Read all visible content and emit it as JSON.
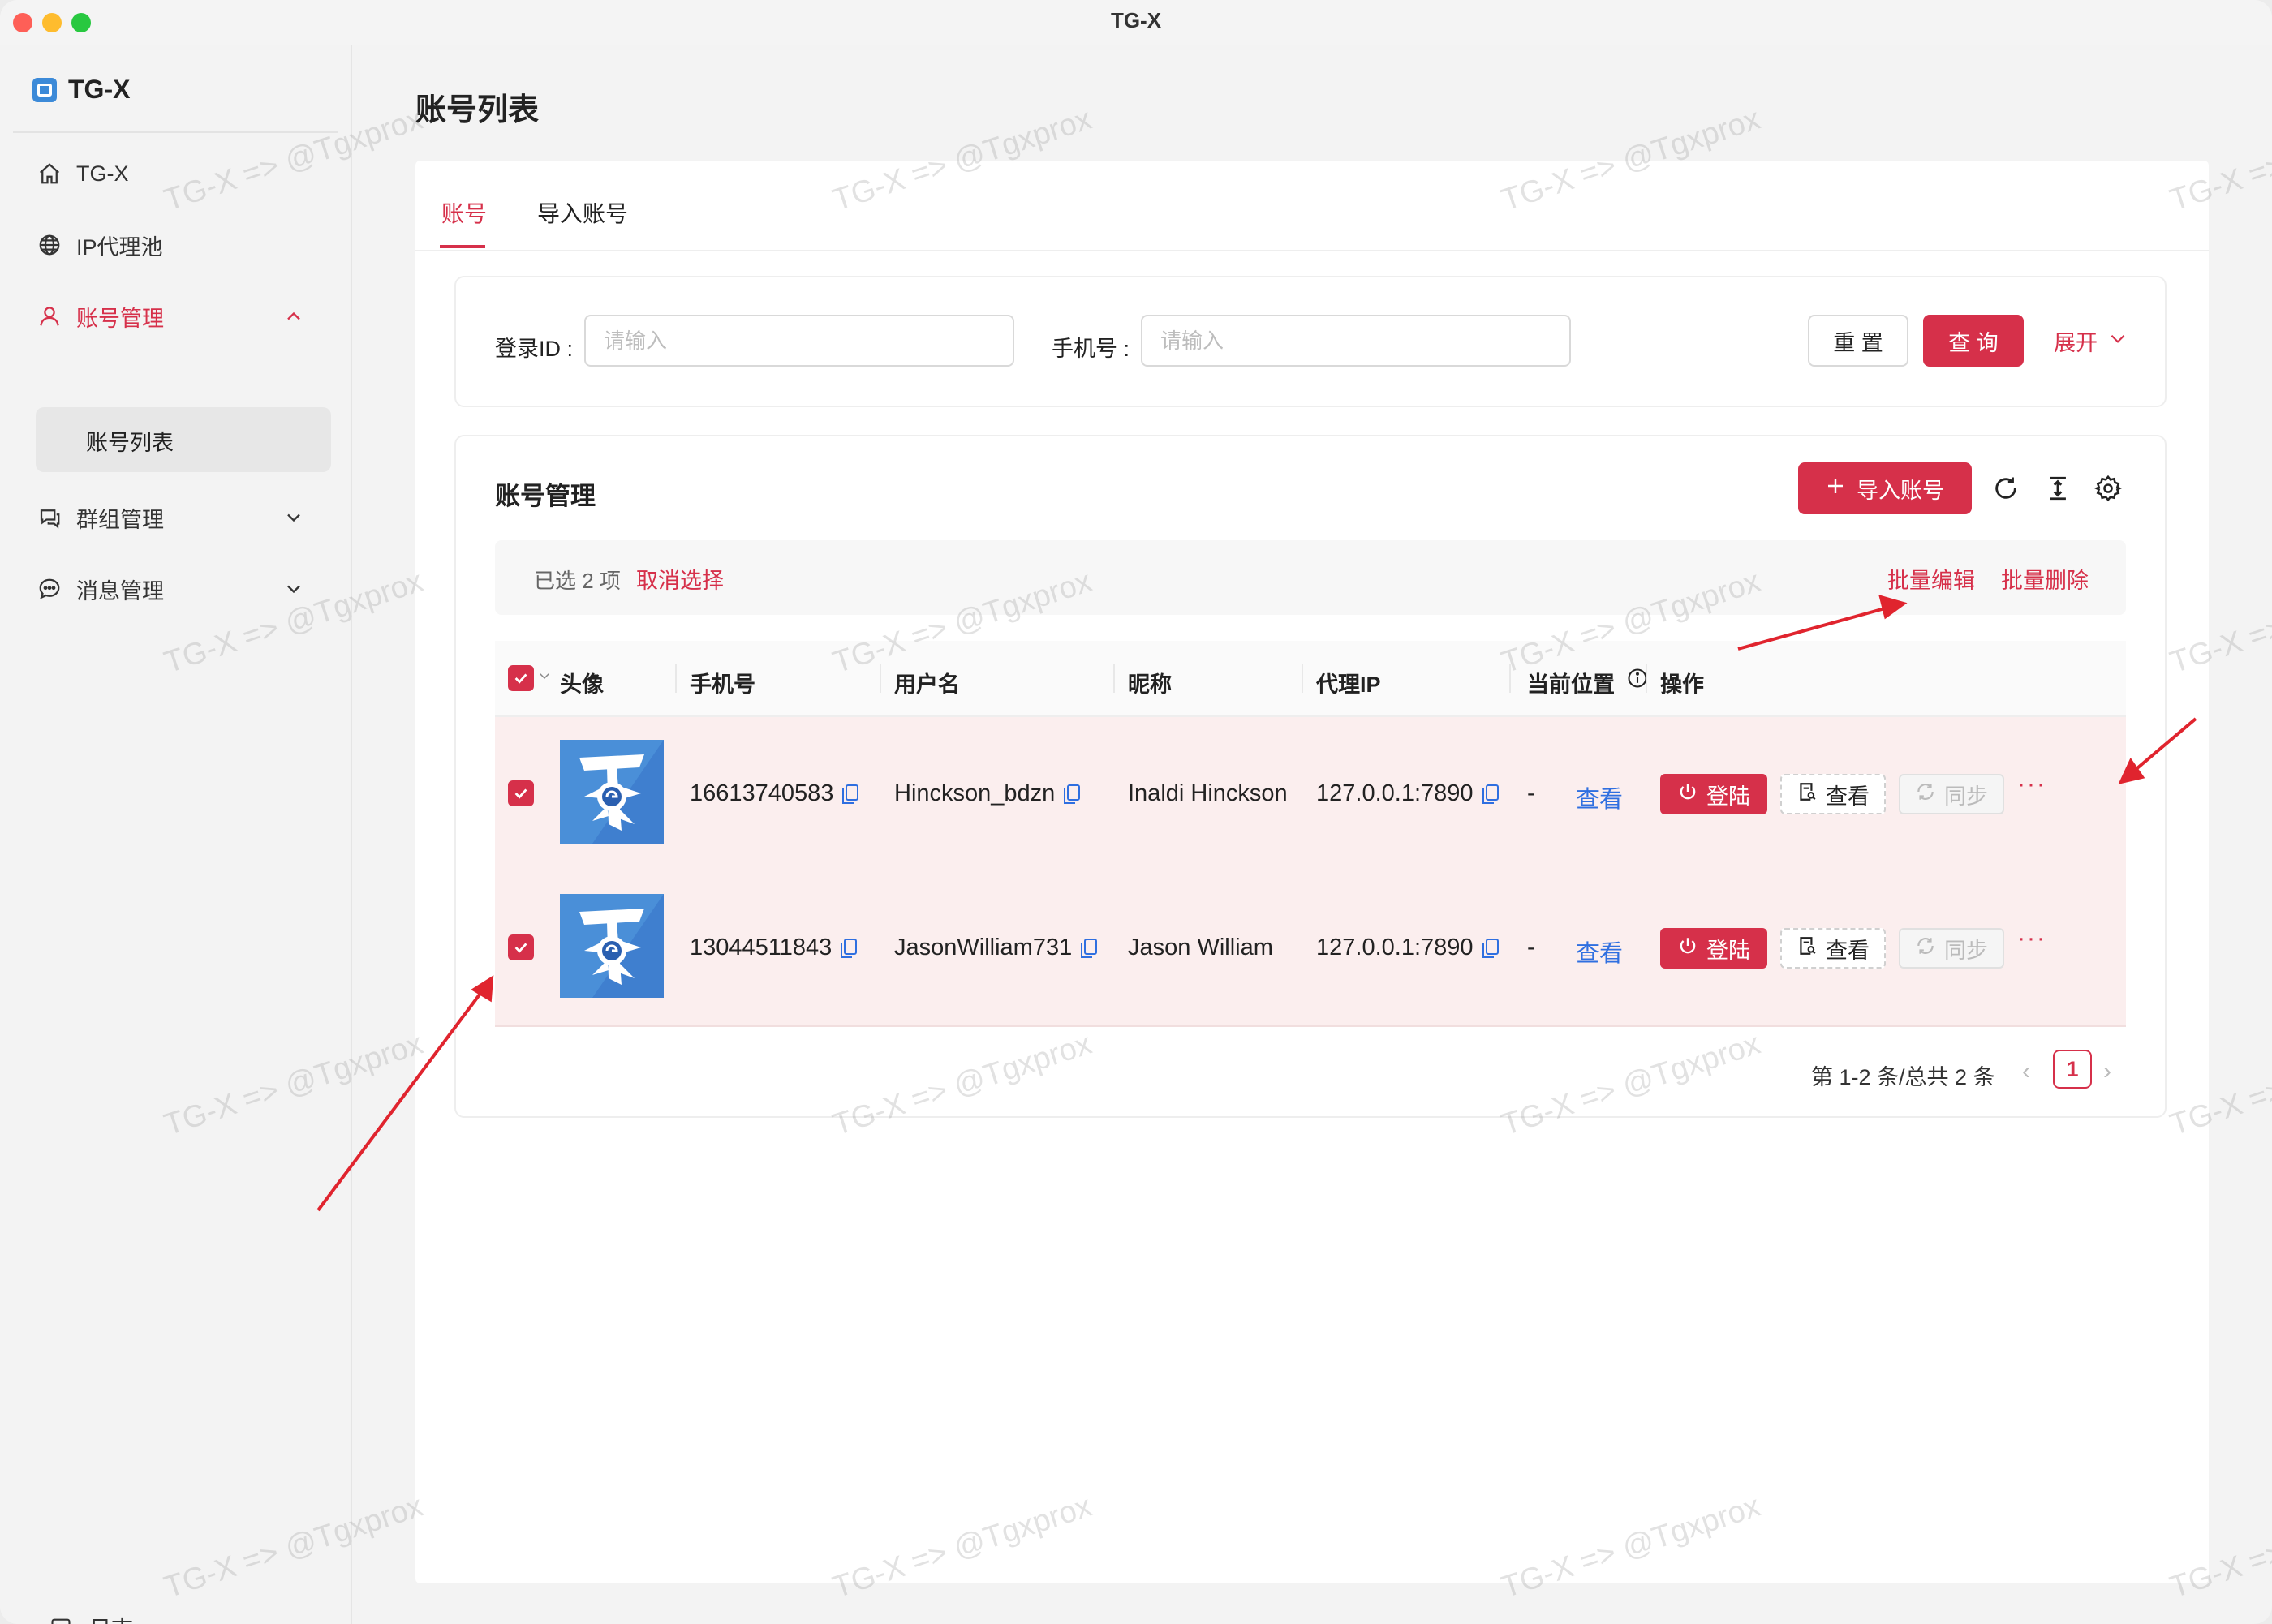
{
  "window": {
    "title": "TG-X"
  },
  "sidebar": {
    "brand": "TG-X",
    "items": [
      {
        "label": "TG-X",
        "icon": "home-icon"
      },
      {
        "label": "IP代理池",
        "icon": "globe-icon"
      },
      {
        "label": "账号管理",
        "icon": "user-icon",
        "active": true,
        "expanded": true
      },
      {
        "label": "群组管理",
        "icon": "chat-group-icon"
      },
      {
        "label": "消息管理",
        "icon": "message-icon"
      }
    ],
    "sub_item": "账号列表",
    "footer": "日志"
  },
  "page": {
    "title": "账号列表"
  },
  "tabs": [
    {
      "label": "账号",
      "active": true
    },
    {
      "label": "导入账号"
    }
  ],
  "filter": {
    "login_id_label": "登录ID :",
    "login_id_placeholder": "请输入",
    "phone_label": "手机号 :",
    "phone_placeholder": "请输入",
    "reset": "重 置",
    "query": "查 询",
    "expand": "展开"
  },
  "table_card": {
    "title": "账号管理",
    "import_button": "导入账号",
    "selection": {
      "info": "已选 2 项",
      "cancel": "取消选择",
      "batch_edit": "批量编辑",
      "batch_delete": "批量删除"
    },
    "columns": [
      "头像",
      "手机号",
      "用户名",
      "昵称",
      "代理IP",
      "当前位置",
      "操作"
    ],
    "rows": [
      {
        "phone": "16613740583",
        "username": "Hinckson_bdzn",
        "nickname": "Inaldi Hinckson",
        "proxy": "127.0.0.1:7890",
        "location": "-",
        "view_link": "查看",
        "login": "登陆",
        "view": "查看",
        "sync": "同步",
        "more": "···"
      },
      {
        "phone": "13044511843",
        "username": "JasonWilliam731",
        "nickname": "Jason William",
        "proxy": "127.0.0.1:7890",
        "location": "-",
        "view_link": "查看",
        "login": "登陆",
        "view": "查看",
        "sync": "同步",
        "more": "···"
      }
    ],
    "pagination": {
      "summary": "第 1-2 条/总共 2 条",
      "current": "1"
    }
  },
  "watermark": "TG-X => @Tgxprox",
  "colors": {
    "accent": "#d6304a",
    "link": "#2f6fe0"
  }
}
